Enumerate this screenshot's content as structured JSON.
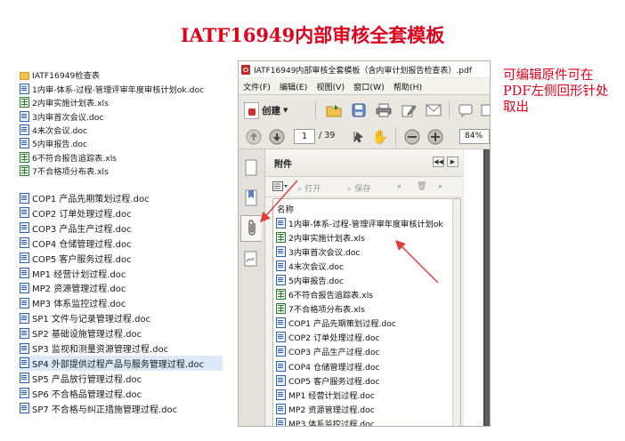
{
  "title": "IATF16949内部审核全套模板",
  "file_list": {
    "folder": "IATF16949检查表",
    "group1": [
      {
        "type": "doc",
        "name": "1内审-体系-过程-管理评审年度审核计划ok.doc"
      },
      {
        "type": "xls",
        "name": "2内审实施计划表.xls"
      },
      {
        "type": "doc",
        "name": "3内审首次会议.doc"
      },
      {
        "type": "doc",
        "name": "4末次会议.doc"
      },
      {
        "type": "doc",
        "name": "5内审报告.doc"
      },
      {
        "type": "xls",
        "name": "6不符合报告追踪表.xls"
      },
      {
        "type": "xls",
        "name": "7不合格项分布表.xls"
      }
    ],
    "group2": [
      {
        "type": "doc",
        "name": "COP1 产品先期策划过程.doc"
      },
      {
        "type": "doc",
        "name": "COP2 订单处理过程.doc"
      },
      {
        "type": "doc",
        "name": "COP3 产品生产过程.doc"
      },
      {
        "type": "doc",
        "name": "COP4 仓储管理过程.doc"
      },
      {
        "type": "doc",
        "name": "COP5 客户服务过程.doc"
      },
      {
        "type": "doc",
        "name": "MP1  经营计划过程.doc"
      },
      {
        "type": "doc",
        "name": "MP2  资源管理过程.doc"
      },
      {
        "type": "doc",
        "name": "MP3 体系监控过程.doc"
      },
      {
        "type": "doc",
        "name": "SP1  文件与记录管理过程.doc"
      },
      {
        "type": "doc",
        "name": "SP2  基础设施管理过程.doc"
      },
      {
        "type": "doc",
        "name": "SP3  监视和测量资源管理过程.doc"
      },
      {
        "type": "doc",
        "name": "SP4  外部提供过程产品与服务管理过程.doc",
        "selected": true
      },
      {
        "type": "doc",
        "name": "SP5  产品放行管理过程.doc"
      },
      {
        "type": "doc",
        "name": "SP6  不合格品管理过程.doc"
      },
      {
        "type": "doc",
        "name": "SP7   不合格与纠正措施管理过程.doc"
      }
    ]
  },
  "acrobat": {
    "window_title": "IATF16949内部审核全套模板（含内审计划报告检查表）.pdf",
    "menu": [
      "文件(F)",
      "编辑(E)",
      "视图(V)",
      "窗口(W)",
      "帮助(H)"
    ],
    "create_label": "创建",
    "page_current": "1",
    "page_total": "/ 39",
    "zoom": "84%",
    "panel_title": "附件",
    "open_label": "打开",
    "save_label": "保存",
    "column_name": "名称",
    "attachments": [
      {
        "type": "doc",
        "name": "1内审-体系-过程-管理评审年度审核计划ok"
      },
      {
        "type": "xls",
        "name": "2内审实施计划表.xls"
      },
      {
        "type": "doc",
        "name": "3内审首次会议.doc"
      },
      {
        "type": "doc",
        "name": "4末次会议.doc"
      },
      {
        "type": "doc",
        "name": "5内审报告.doc"
      },
      {
        "type": "xls",
        "name": "6不符合报告追踪表.xls"
      },
      {
        "type": "xls",
        "name": "7不合格项分布表.xls"
      },
      {
        "type": "doc",
        "name": "COP1 产品先期策划过程.doc"
      },
      {
        "type": "doc",
        "name": "COP2 订单处理过程.doc"
      },
      {
        "type": "doc",
        "name": "COP3 产品生产过程.doc"
      },
      {
        "type": "doc",
        "name": "COP4 仓储管理过程.doc"
      },
      {
        "type": "doc",
        "name": "COP5 客户服务过程.doc"
      },
      {
        "type": "doc",
        "name": "MP1 经营计划过程.doc"
      },
      {
        "type": "doc",
        "name": "MP2 资源管理过程.doc"
      },
      {
        "type": "doc",
        "name": "MP3 体系监控过程.doc"
      }
    ]
  },
  "note": "可编辑原件可在PDF左侧回形针处取出",
  "colors": {
    "accent_red": "#e0001b",
    "arrow_red": "#e53935"
  }
}
